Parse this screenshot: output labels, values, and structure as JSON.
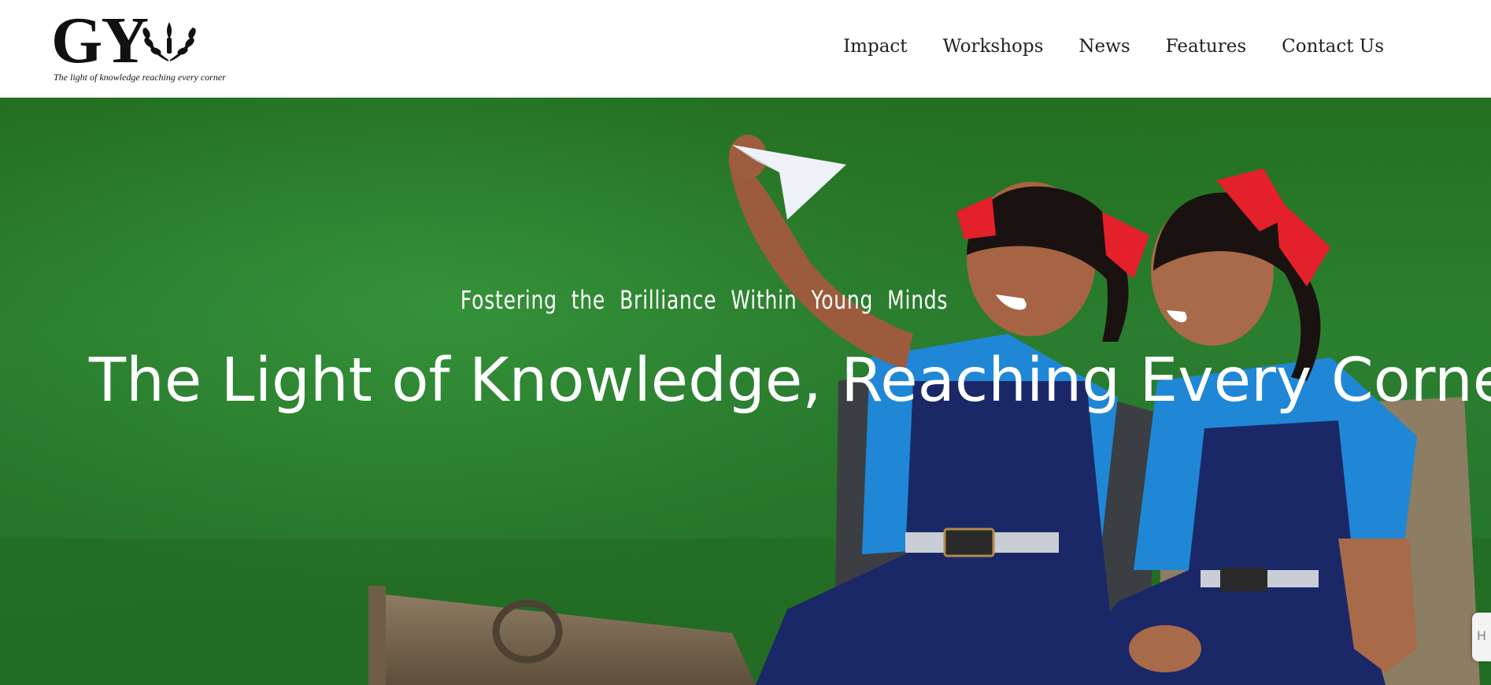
{
  "logo": {
    "mark": "GY",
    "tagline": "The light of knowledge reaching every corner"
  },
  "nav": {
    "items": [
      {
        "label": "Impact"
      },
      {
        "label": "Workshops"
      },
      {
        "label": "News"
      },
      {
        "label": "Features"
      },
      {
        "label": "Contact Us"
      }
    ]
  },
  "hero": {
    "subtitle": "Fostering the Brilliance Within Young Minds",
    "title": "The Light of Knowledge, Reaching Every Corner"
  },
  "side_tab": {
    "icon": "accessibility-icon",
    "label": "H"
  },
  "colors": {
    "grass": "#2b8030",
    "uniform_blue": "#1f87d6",
    "pinafore_navy": "#1b2868",
    "ribbon_red": "#e4202b",
    "text_white": "#ffffff"
  }
}
